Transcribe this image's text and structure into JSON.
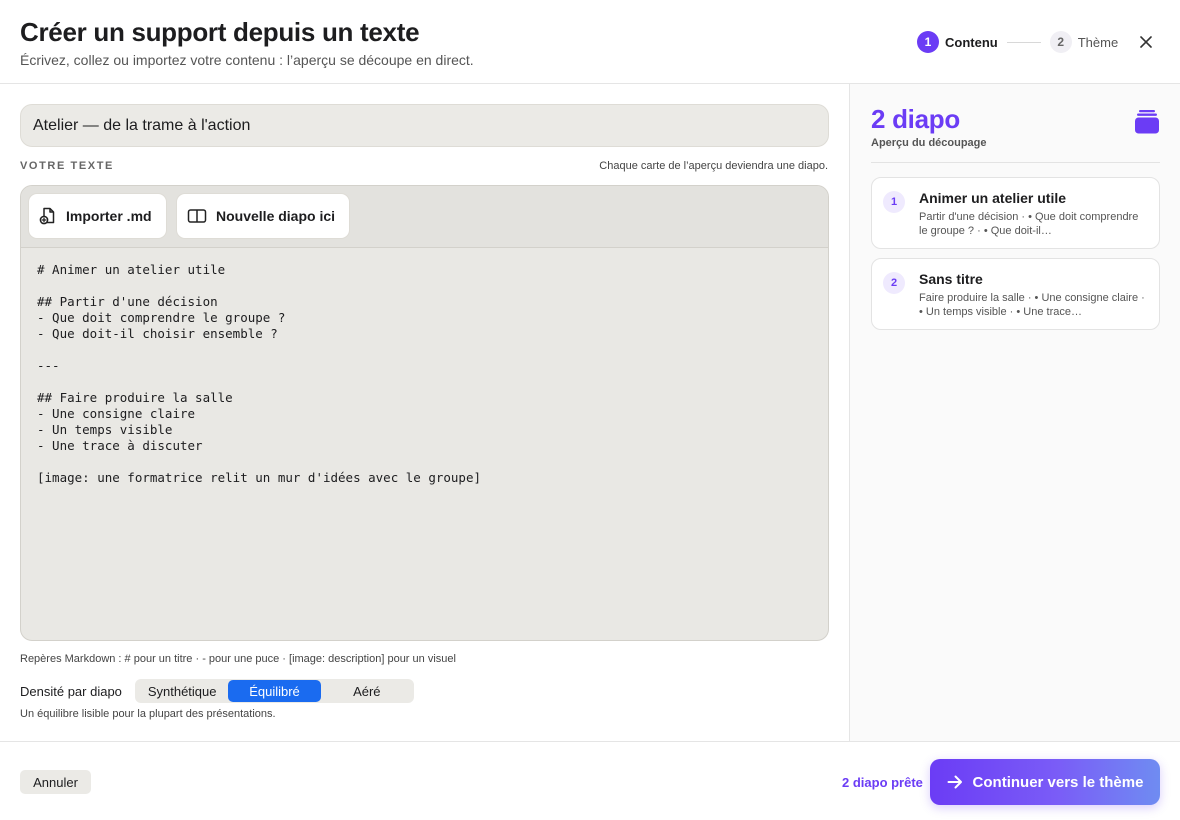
{
  "header": {
    "title": "Créer un support depuis un texte",
    "subtitle": "Écrivez, collez ou importez votre contenu : l’aperçu se découpe en direct.",
    "steps": [
      {
        "num": "1",
        "label": "Contenu"
      },
      {
        "num": "2",
        "label": "Thème"
      }
    ],
    "close_icon": "close-icon"
  },
  "editor": {
    "title_value": "Atelier — de la trame à l'action",
    "section_label": "VOTRE TEXTE",
    "section_hint": "Chaque carte de l’aperçu deviendra une diapo.",
    "toolbar": {
      "import_label": "Importer .md",
      "import_icon": "file-import-icon",
      "new_slide_label": "Nouvelle diapo ici",
      "new_slide_icon": "split-layout-icon"
    },
    "content": "# Animer un atelier utile\n\n## Partir d'une décision\n- Que doit comprendre le groupe ?\n- Que doit-il choisir ensemble ?\n\n---\n\n## Faire produire la salle\n- Une consigne claire\n- Un temps visible\n- Une trace à discuter\n\n[image: une formatrice relit un mur d'idées avec le groupe]",
    "markdown_hint": "Repères Markdown : # pour un titre · - pour une puce · [image: description] pour un visuel",
    "density": {
      "label": "Densité par diapo",
      "options": [
        "Synthétique",
        "Équilibré",
        "Aéré"
      ],
      "selected": "Équilibré",
      "hint": "Un équilibre lisible pour la plupart des présentations."
    }
  },
  "preview": {
    "count_title": "2 diapo",
    "subtitle": "Aperçu du découpage",
    "icon": "stack-icon",
    "cards": [
      {
        "num": "1",
        "title": "Animer un atelier utile",
        "body": "Partir d'une décision · • Que doit comprendre le groupe ? · • Que doit-il…"
      },
      {
        "num": "2",
        "title": "Sans titre",
        "body": "Faire produire la salle · • Une consigne claire · • Un temps visible · • Une trace…"
      }
    ]
  },
  "footer": {
    "cancel_label": "Annuler",
    "ready_text": "2 diapo prête",
    "continue_label": "Continuer vers le thème",
    "continue_icon": "arrow-right-icon"
  },
  "colors": {
    "accent": "#6b3cf5",
    "segment_active": "#1a6bf0",
    "editor_bg": "#e9e8e4"
  }
}
